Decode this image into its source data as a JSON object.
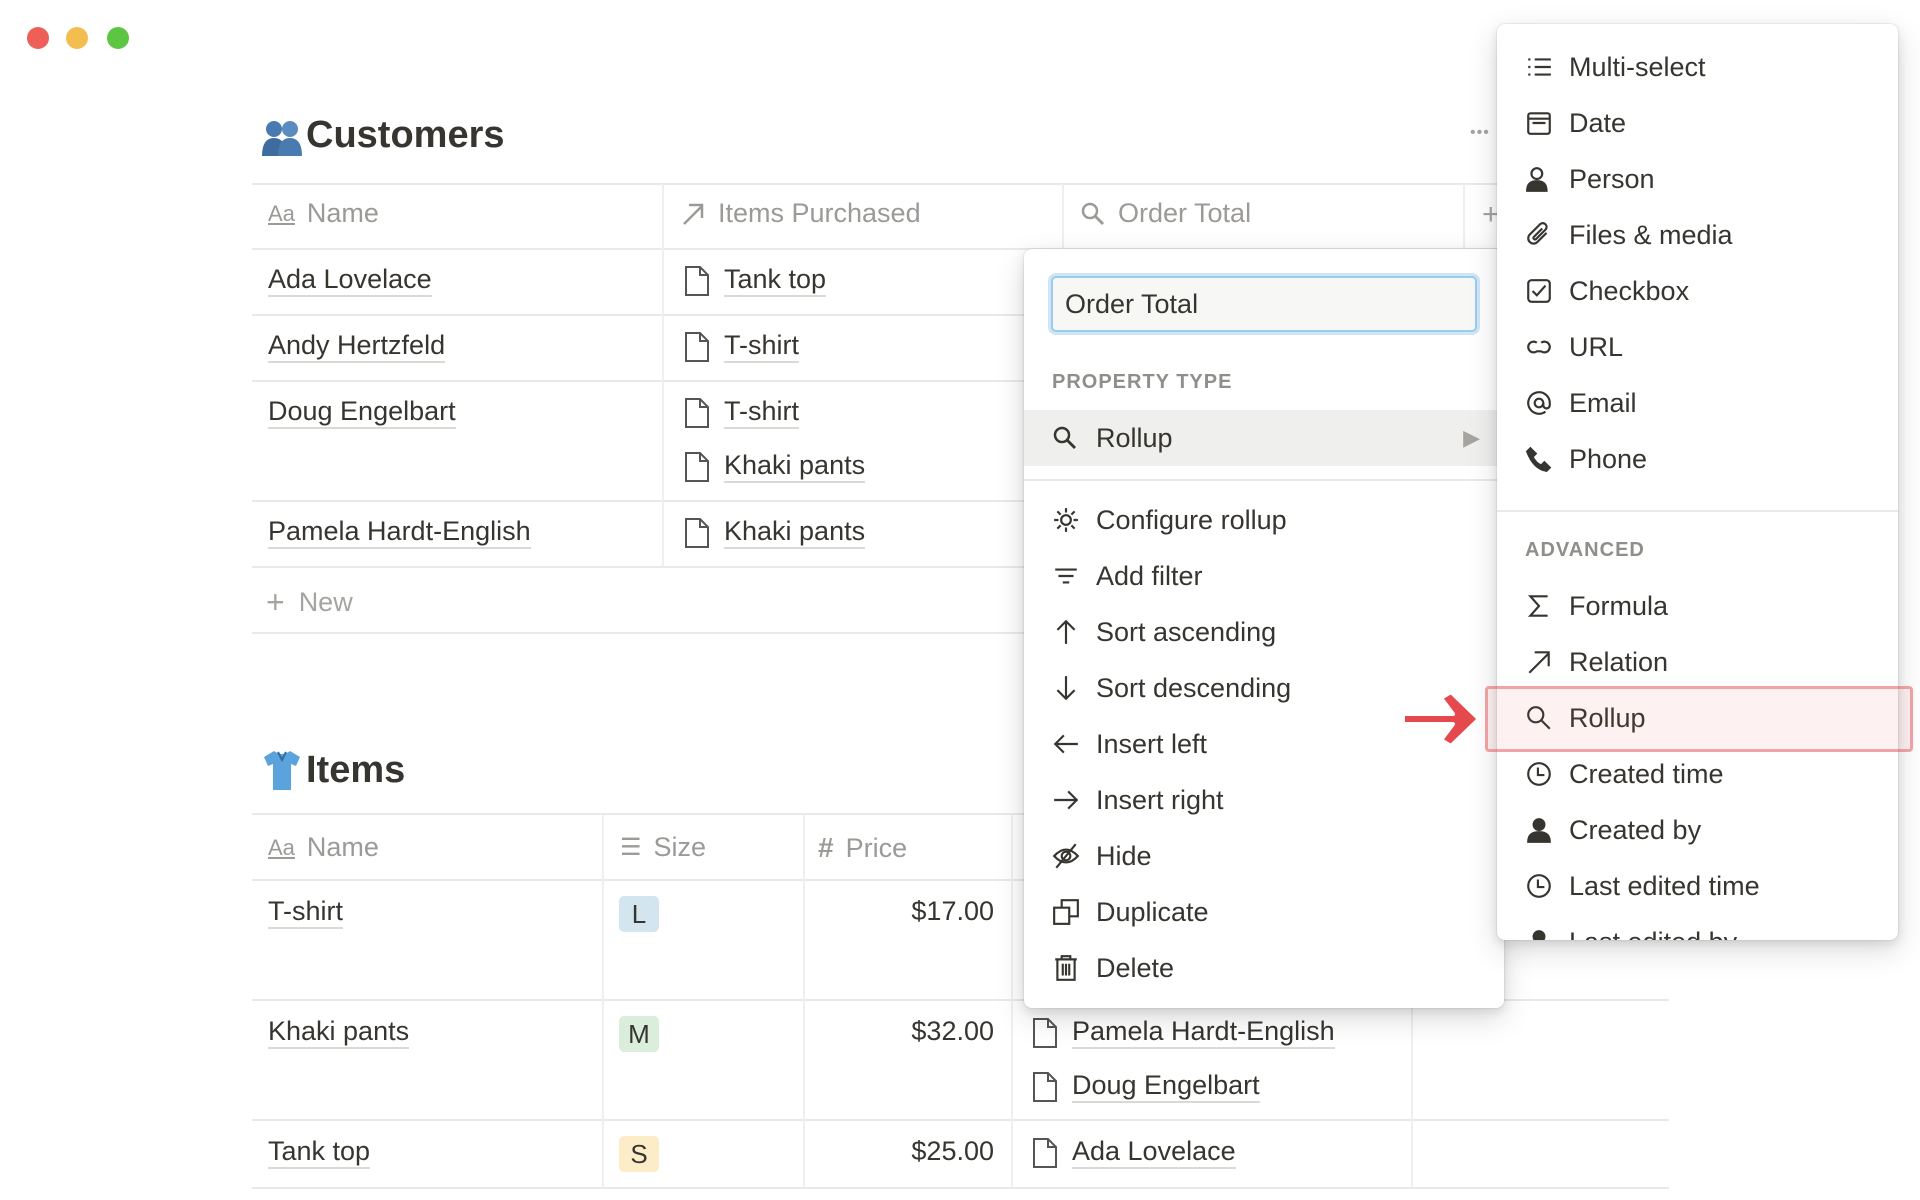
{
  "window": {
    "controls": [
      "close",
      "minimize",
      "maximize"
    ],
    "colors": {
      "close": "#ee5f57",
      "minimize": "#f4bd4f",
      "maximize": "#5ec543"
    }
  },
  "customers": {
    "title": "Customers",
    "icon": "busts-in-silhouette-emoji",
    "columns": [
      {
        "label": "Name",
        "icon": "text-aa-icon"
      },
      {
        "label": "Items Purchased",
        "icon": "relation-arrow-icon"
      },
      {
        "label": "Order Total",
        "icon": "search-icon"
      }
    ],
    "rows": [
      {
        "name": "Ada Lovelace",
        "items": [
          "Tank top"
        ]
      },
      {
        "name": "Andy Hertzfeld",
        "items": [
          "T-shirt"
        ]
      },
      {
        "name": "Doug Engelbart",
        "items": [
          "T-shirt",
          "Khaki pants"
        ]
      },
      {
        "name": "Pamela Hardt-English",
        "items": [
          "Khaki pants"
        ]
      }
    ],
    "new_label": "New",
    "more": "•••",
    "add": "+"
  },
  "items": {
    "title": "Items",
    "icon": "t-shirt-emoji",
    "columns": [
      {
        "label": "Name",
        "icon": "text-aa-icon"
      },
      {
        "label": "Size",
        "icon": "list-icon"
      },
      {
        "label": "Price",
        "icon": "hash-icon"
      }
    ],
    "rows": [
      {
        "name": "T-shirt",
        "size": "L",
        "size_color": "#d3e5ef",
        "price": "$17.00",
        "customers": []
      },
      {
        "name": "Khaki pants",
        "size": "M",
        "size_color": "#dbeddb",
        "price": "$32.00",
        "customers": [
          "Pamela Hardt-English",
          "Doug Engelbart"
        ]
      },
      {
        "name": "Tank top",
        "size": "S",
        "size_color": "#fdecc8",
        "price": "$25.00",
        "customers": [
          "Ada Lovelace"
        ]
      }
    ]
  },
  "property_menu": {
    "name_value": "Order Total",
    "section_label": "PROPERTY TYPE",
    "type_selected": "Rollup",
    "actions": [
      "Configure rollup",
      "Add filter",
      "Sort ascending",
      "Sort descending",
      "Insert left",
      "Insert right",
      "Hide",
      "Duplicate",
      "Delete"
    ]
  },
  "type_menu": {
    "basic": [
      "Multi-select",
      "Date",
      "Person",
      "Files & media",
      "Checkbox",
      "URL",
      "Email",
      "Phone"
    ],
    "advanced_label": "ADVANCED",
    "advanced": [
      "Formula",
      "Relation",
      "Rollup",
      "Created time",
      "Created by",
      "Last edited time",
      "Last edited by"
    ],
    "highlighted": "Rollup",
    "highlight_color": "#e5484d"
  }
}
